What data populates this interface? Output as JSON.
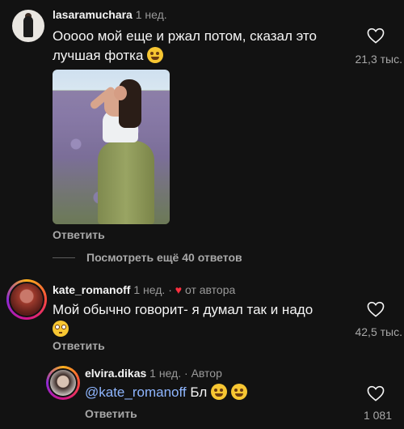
{
  "comments": [
    {
      "username": "lasaramuchara",
      "time": "1 нед.",
      "text_line1": "Ооооо мой еще и ржал потом, сказал это",
      "text_line2": "лучшая фотка",
      "likes": "21,3 тыс.",
      "reply_label": "Ответить",
      "emoji": "rofl-emoji"
    },
    {
      "username": "kate_romanoff",
      "time": "1 нед.",
      "separator": "·",
      "author_like": "от автора",
      "text": "Мой обычно говорит- я думал так и надо",
      "likes": "42,5 тыс.",
      "reply_label": "Ответить",
      "emoji": "flushed-emoji"
    },
    {
      "username": "elvira.dikas",
      "time": "1 нед.",
      "separator": "·",
      "author_tag": "Автор",
      "mention": "@kate_romanoff",
      "text": "Бл",
      "likes": "1 081",
      "reply_label": "Ответить",
      "emoji": "laughing-tears-emoji"
    }
  ],
  "view_more": "Посмотреть ещё 40 ответов",
  "colors": {
    "background": "#121212",
    "mention": "#8fb6ff",
    "heart_red": "#ff3040"
  }
}
